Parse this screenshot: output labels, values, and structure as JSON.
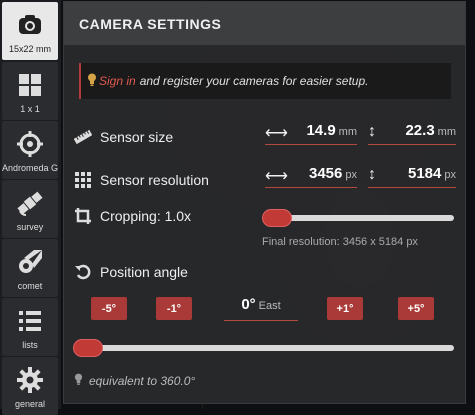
{
  "sidebar": {
    "items": [
      {
        "label": "15x22 mm",
        "icon": "camera-icon",
        "active": true
      },
      {
        "label": "1 x 1",
        "icon": "grid-icon",
        "active": false
      },
      {
        "label": "Andromeda Galaxy",
        "icon": "crosshair-icon",
        "active": false
      },
      {
        "label": "survey",
        "icon": "satellite-icon",
        "active": false
      },
      {
        "label": "comet",
        "icon": "comet-icon",
        "active": false
      },
      {
        "label": "lists",
        "icon": "list-icon",
        "active": false
      },
      {
        "label": "general",
        "icon": "gear-icon",
        "active": false
      }
    ]
  },
  "panel": {
    "title": "CAMERA SETTINGS",
    "notice": {
      "link": "Sign in",
      "text": "and register your cameras for easier setup."
    },
    "sensor_size": {
      "label": "Sensor size",
      "width": "14.9",
      "height": "22.3",
      "unit": "mm"
    },
    "sensor_resolution": {
      "label": "Sensor resolution",
      "width": "3456",
      "height": "5184",
      "unit": "px"
    },
    "cropping": {
      "label": "Cropping: 1.0x",
      "value": 1.0,
      "final_resolution": "Final resolution: 3456 x 5184 px"
    },
    "position_angle": {
      "label": "Position angle",
      "buttons": [
        "-5°",
        "-1°",
        "+1°",
        "+5°"
      ],
      "value": "0°",
      "direction": "East",
      "equivalent": "equivalent to  360.0°"
    }
  },
  "colors": {
    "accent": "#c23a36",
    "panel_bg": "#2a2a2c",
    "header_bg": "#3d3e40"
  }
}
